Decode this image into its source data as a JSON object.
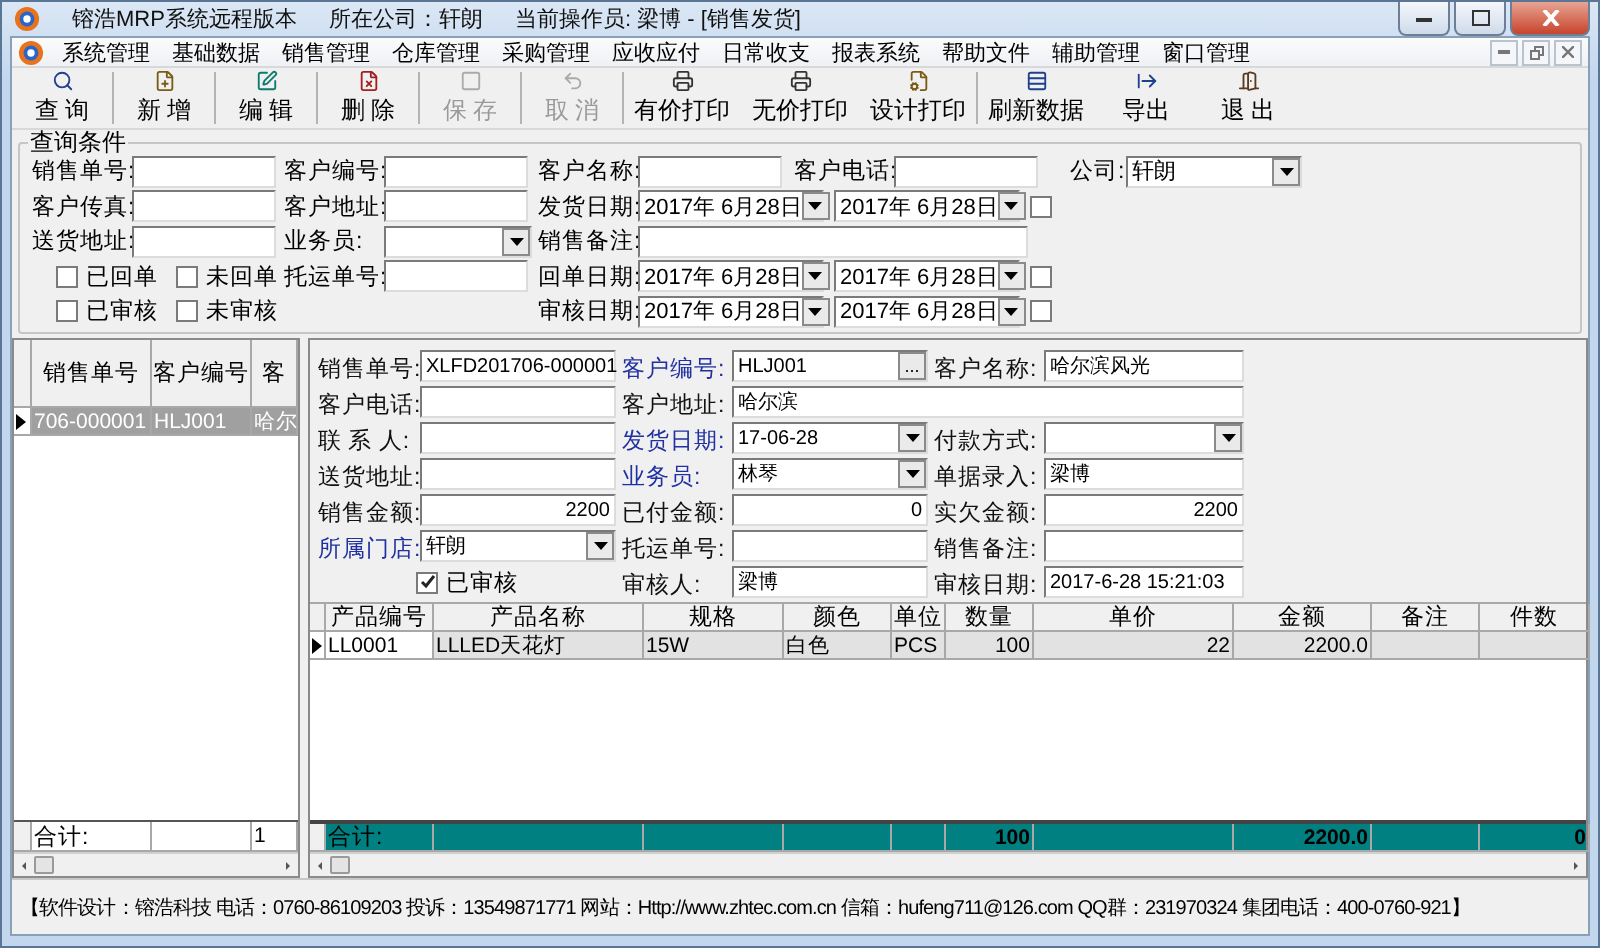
{
  "window": {
    "app_name": "镕浩MRP系统远程版本",
    "company": "所在公司：轩朗",
    "operator": "当前操作员: 梁博 - [销售发货]"
  },
  "menu": [
    "系统管理",
    "基础数据",
    "销售管理",
    "仓库管理",
    "采购管理",
    "应收应付",
    "日常收支",
    "报表系统",
    "帮助文件",
    "辅助管理",
    "窗口管理"
  ],
  "toolbar": [
    {
      "label": "查 询",
      "disabled": false,
      "group_end": true
    },
    {
      "label": "新 增",
      "disabled": false,
      "group_end": true
    },
    {
      "label": "编 辑",
      "disabled": false,
      "group_end": true
    },
    {
      "label": "删 除",
      "disabled": false,
      "group_end": true
    },
    {
      "label": "保 存",
      "disabled": true,
      "group_end": true
    },
    {
      "label": "取 消",
      "disabled": true,
      "group_end": true
    },
    {
      "label": "有价打印",
      "disabled": false,
      "group_end": false
    },
    {
      "label": "无价打印",
      "disabled": false,
      "group_end": false
    },
    {
      "label": "设计打印",
      "disabled": false,
      "group_end": true
    },
    {
      "label": "刷新数据",
      "disabled": false,
      "group_end": false
    },
    {
      "label": "导出",
      "disabled": false,
      "group_end": false
    },
    {
      "label": "退 出",
      "disabled": false,
      "group_end": false
    }
  ],
  "query": {
    "title": "查询条件",
    "rows": [
      {
        "left": [
          {
            "kind": "field",
            "label": "销售单号:"
          }
        ],
        "middle": [
          {
            "kind": "field",
            "label": "客户编号:"
          }
        ],
        "right": [
          {
            "kind": "field",
            "label": "客户名称:"
          },
          {
            "kind": "field",
            "label": "客户电话:"
          },
          {
            "kind": "select",
            "label": "公司:",
            "value": "轩朗"
          }
        ]
      },
      {
        "left": [
          {
            "kind": "field",
            "label": "客户传真:"
          }
        ],
        "middle": [
          {
            "kind": "field",
            "label": "客户地址:"
          }
        ],
        "right": [
          {
            "kind": "date_range",
            "label": "发货日期:",
            "from": "2017年 6月28日",
            "to": "2017年 6月28日",
            "checked": false
          }
        ]
      },
      {
        "left": [
          {
            "kind": "field",
            "label": "送货地址:"
          }
        ],
        "middle": [
          {
            "kind": "select",
            "label": "业务员:"
          }
        ],
        "right": [
          {
            "kind": "field",
            "label": "销售备注:",
            "wide": true
          }
        ]
      },
      {
        "left": [
          {
            "kind": "checkbox",
            "label": "已回单",
            "checked": false
          },
          {
            "kind": "checkbox",
            "label": "未回单",
            "checked": false
          }
        ],
        "middle": [
          {
            "kind": "field",
            "label": "托运单号:"
          }
        ],
        "right": [
          {
            "kind": "date_range",
            "label": "回单日期:",
            "from": "2017年 6月28日",
            "to": "2017年 6月28日",
            "checked": false
          }
        ]
      },
      {
        "left": [
          {
            "kind": "checkbox",
            "label": "已审核",
            "checked": false
          },
          {
            "kind": "checkbox",
            "label": "未审核",
            "checked": false
          }
        ],
        "right": [
          {
            "kind": "date_range",
            "label": "审核日期:",
            "from": "2017年 6月28日",
            "to": "2017年 6月28日",
            "checked": false
          }
        ]
      }
    ]
  },
  "order_list": {
    "columns": [
      "销售单号",
      "客户编号",
      "客"
    ],
    "rows": [
      {
        "cells": [
          "706-000001",
          "HLJ001",
          "哈尔"
        ],
        "selected": true
      }
    ],
    "totals": {
      "label": "合计:",
      "count": "1"
    }
  },
  "order_form": {
    "rows": [
      [
        {
          "kind": "text",
          "label": "销售单号:",
          "value": "XLFD201706-000001",
          "link": false
        },
        {
          "kind": "lookup",
          "label": "客户编号:",
          "value": "HLJ001",
          "button": "...",
          "link": true
        },
        {
          "kind": "text",
          "label": "客户名称:",
          "value": "哈尔滨风光",
          "link": false
        }
      ],
      [
        {
          "kind": "text",
          "label": "客户电话:",
          "link": false
        },
        {
          "kind": "text",
          "label": "客户地址:",
          "value": "哈尔滨",
          "link": false,
          "wide": true
        }
      ],
      [
        {
          "kind": "text",
          "label": "联 系 人:",
          "link": false
        },
        {
          "kind": "select",
          "label": "发货日期:",
          "value": "17-06-28",
          "link": true
        },
        {
          "kind": "select",
          "label": "付款方式:",
          "link": false
        }
      ],
      [
        {
          "kind": "text",
          "label": "送货地址:",
          "link": false
        },
        {
          "kind": "select",
          "label": "业务员:",
          "value": "林琴",
          "link": true
        },
        {
          "kind": "text",
          "label": "单据录入:",
          "value": "梁博",
          "link": false
        }
      ],
      [
        {
          "kind": "number",
          "label": "销售金额:",
          "value": "2200",
          "link": false
        },
        {
          "kind": "number",
          "label": "已付金额:",
          "value": "0",
          "link": false
        },
        {
          "kind": "number",
          "label": "实欠金额:",
          "value": "2200",
          "link": false
        }
      ],
      [
        {
          "kind": "select",
          "label": "所属门店:",
          "value": "轩朗",
          "link": true
        },
        {
          "kind": "text",
          "label": "托运单号:",
          "link": false
        },
        {
          "kind": "text",
          "label": "销售备注:",
          "link": false
        }
      ],
      [
        {
          "kind": "checkbox",
          "label": "已审核",
          "checked": true
        },
        {
          "kind": "text",
          "label": "审核人:",
          "value": "梁博",
          "link": false
        },
        {
          "kind": "text",
          "label": "审核日期:",
          "value": "2017-6-28 15:21:03",
          "link": false
        }
      ]
    ]
  },
  "detail_table": {
    "columns": [
      "产品编号",
      "产品名称",
      "规格",
      "颜色",
      "单位",
      "数量",
      "单价",
      "金额",
      "备注",
      "件数"
    ],
    "rows": [
      {
        "cells": [
          "LL0001",
          "LLLED天花灯",
          "15W",
          "白色",
          "PCS",
          "100",
          "22",
          "2200.0"
        ],
        "selected": true
      }
    ],
    "totals": {
      "label": "合计:",
      "quantity": "100",
      "amount": "2200.0",
      "pieces": "0"
    }
  },
  "status_bar": "【软件设计：镕浩科技 电话：0760-86109203  投诉：13549871771 网站：Http://www.zhtec.com.cn 信箱：hufeng711@126.com QQ群：231970324 集团电话：400-0760-921】"
}
